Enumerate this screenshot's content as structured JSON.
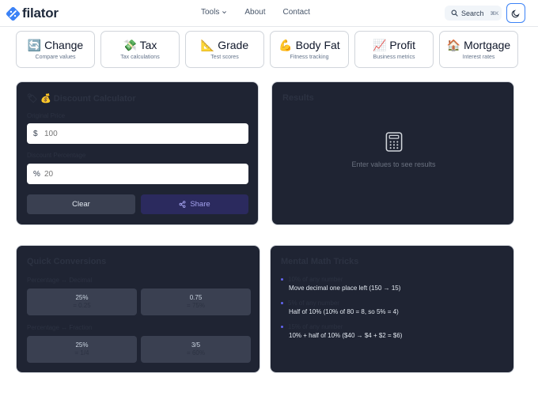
{
  "brand": {
    "name": "filator"
  },
  "nav": {
    "tools": "Tools",
    "about": "About",
    "contact": "Contact"
  },
  "search": {
    "label": "Search",
    "shortcut": "⌘K"
  },
  "categories": [
    {
      "emoji": "🔄",
      "title": "Change",
      "subtitle": "Compare values"
    },
    {
      "emoji": "💸",
      "title": "Tax",
      "subtitle": "Tax calculations"
    },
    {
      "emoji": "📐",
      "title": "Grade",
      "subtitle": "Test scores"
    },
    {
      "emoji": "💪",
      "title": "Body Fat",
      "subtitle": "Fitness tracking"
    },
    {
      "emoji": "📈",
      "title": "Profit",
      "subtitle": "Business metrics"
    },
    {
      "emoji": "🏠",
      "title": "Mortgage",
      "subtitle": "Interest rates"
    }
  ],
  "calculator": {
    "title": "🏷 💰 Discount Calculator",
    "original_label": "Original Price",
    "original_prefix": "$",
    "original_value": "100",
    "discount_label": "Discount Percentage",
    "discount_prefix": "%",
    "discount_value": "20",
    "clear_label": "Clear",
    "share_label": "Share"
  },
  "results": {
    "title": "Results",
    "empty_text": "Enter values to see results"
  },
  "conversions": {
    "title": "Quick Conversions",
    "decimal_label": "Percentage ↔ Decimal",
    "decimal_tiles": [
      {
        "top": "25%",
        "bottom": "= 0.25"
      },
      {
        "top": "0.75",
        "bottom": "= 75%"
      }
    ],
    "fraction_label": "Percentage ↔ Fraction",
    "fraction_tiles": [
      {
        "top": "25%",
        "bottom": "= 1/4"
      },
      {
        "top": "3/5",
        "bottom": "= 60%"
      }
    ]
  },
  "tricks": {
    "title": "Mental Math Tricks",
    "items": [
      {
        "title": "10% of any number",
        "desc": "Move decimal one place left (150 → 15)"
      },
      {
        "title": "5% of any number",
        "desc": "Half of 10% (10% of 80 = 8, so 5% = 4)"
      },
      {
        "title": "15% of any number",
        "desc": "10% + half of 10% ($40 → $4 + $2 = $6)"
      }
    ]
  },
  "colors": {
    "accent": "#3b82f6",
    "card_bg": "#1f2433",
    "share_text": "#a5a3f0",
    "bullet": "#6366f1"
  }
}
